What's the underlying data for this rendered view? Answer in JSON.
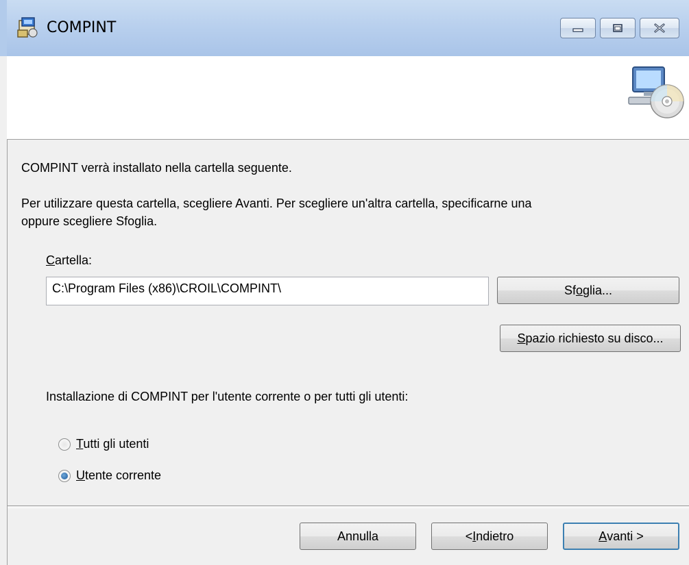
{
  "window": {
    "title": "COMPINT",
    "icon": "installer-icon"
  },
  "caption_buttons": {
    "minimize": "minimize-icon",
    "maximize": "maximize-icon",
    "close": "close-icon"
  },
  "banner": {
    "icon": "computer-cd-icon"
  },
  "body": {
    "intro": "COMPINT verrà installato nella cartella seguente.",
    "instructions_line1": "Per utilizzare questa cartella, scegliere Avanti. Per scegliere un'altra cartella, specificarne una",
    "instructions_line2": "oppure scegliere Sfoglia.",
    "folder_label_accel": "C",
    "folder_label_rest": "artella:",
    "folder_value": "C:\\Program Files (x86)\\CROIL\\COMPINT\\",
    "browse_pre": "Sf",
    "browse_accel": "o",
    "browse_post": "glia...",
    "disk_accel": "S",
    "disk_rest": "pazio richiesto su disco...",
    "install_for_label": "Installazione di COMPINT per l'utente corrente o per tutti gli utenti:",
    "radio_all_accel": "T",
    "radio_all_rest": "utti gli utenti",
    "radio_current_accel": "U",
    "radio_current_rest": "tente corrente",
    "selected_option": "Utente corrente"
  },
  "footer": {
    "cancel": "Annulla",
    "back_pre": "< ",
    "back_accel": "I",
    "back_rest": "ndietro",
    "next_accel": "A",
    "next_rest": "vanti >"
  }
}
